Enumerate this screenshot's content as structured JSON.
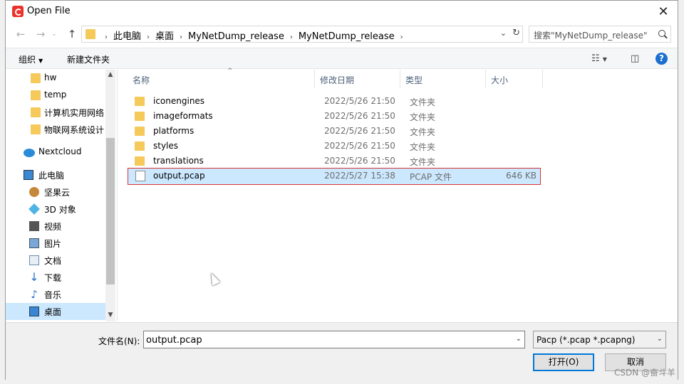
{
  "window": {
    "title": "Open File",
    "close_glyph": "✕"
  },
  "address": {
    "crumbs": [
      "此电脑",
      "桌面",
      "MyNetDump_release",
      "MyNetDump_release"
    ],
    "search_placeholder": "搜索\"MyNetDump_release\""
  },
  "toolbar": {
    "organize": "组织",
    "new_folder": "新建文件夹"
  },
  "sidebar": {
    "items": [
      {
        "label": "hw",
        "icon": "folder-icon"
      },
      {
        "label": "temp",
        "icon": "folder-icon"
      },
      {
        "label": "计算机实用网络",
        "icon": "folder-icon"
      },
      {
        "label": "物联网系统设计",
        "icon": "folder-icon"
      },
      {
        "label": "Nextcloud",
        "icon": "cloud-icon"
      },
      {
        "label": "此电脑",
        "icon": "computer-icon"
      },
      {
        "label": "坚果云",
        "icon": "nut-icon"
      },
      {
        "label": "3D 对象",
        "icon": "3d-objects-icon"
      },
      {
        "label": "视频",
        "icon": "video-icon"
      },
      {
        "label": "图片",
        "icon": "pictures-icon"
      },
      {
        "label": "文档",
        "icon": "documents-icon"
      },
      {
        "label": "下载",
        "icon": "download-icon"
      },
      {
        "label": "音乐",
        "icon": "music-icon"
      },
      {
        "label": "桌面",
        "icon": "desktop-icon"
      }
    ]
  },
  "columns": {
    "name": "名称",
    "modified": "修改日期",
    "type": "类型",
    "size": "大小"
  },
  "files": [
    {
      "name": "iconengines",
      "modified": "2022/5/26 21:50",
      "type": "文件夹",
      "size": "",
      "kind": "folder"
    },
    {
      "name": "imageformats",
      "modified": "2022/5/26 21:50",
      "type": "文件夹",
      "size": "",
      "kind": "folder"
    },
    {
      "name": "platforms",
      "modified": "2022/5/26 21:50",
      "type": "文件夹",
      "size": "",
      "kind": "folder"
    },
    {
      "name": "styles",
      "modified": "2022/5/26 21:50",
      "type": "文件夹",
      "size": "",
      "kind": "folder"
    },
    {
      "name": "translations",
      "modified": "2022/5/26 21:50",
      "type": "文件夹",
      "size": "",
      "kind": "folder"
    },
    {
      "name": "output.pcap",
      "modified": "2022/5/27 15:38",
      "type": "PCAP 文件",
      "size": "646 KB",
      "kind": "file"
    }
  ],
  "footer": {
    "filename_label": "文件名(N):",
    "filename_value": "output.pcap",
    "filter": "Pacp (*.pcap *.pcapng)",
    "open_button": "打开(O)",
    "cancel_button": "取消"
  },
  "watermark": "CSDN @奋斗羊",
  "colors": {
    "selection": "#cce8ff",
    "highlight_border": "#d93434",
    "folder": "#f5c95a",
    "accent": "#0078d7"
  }
}
